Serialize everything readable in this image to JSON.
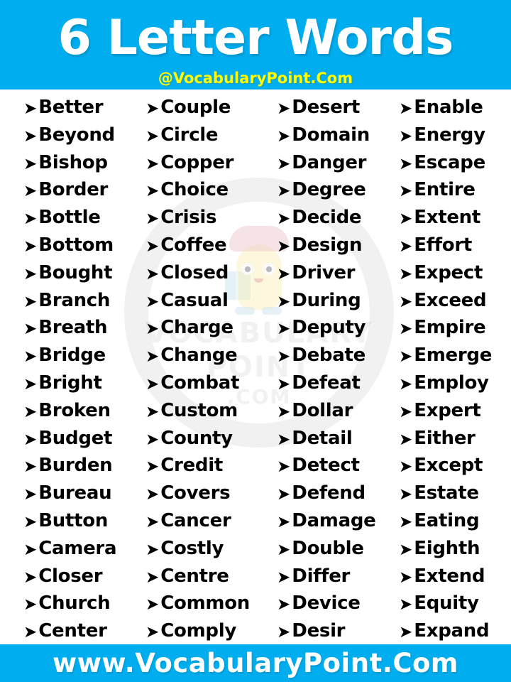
{
  "header": {
    "title": "6 Letter Words",
    "subtitle": "@VocabularyPoint.Com",
    "background_color": "#00ADEE",
    "title_color": "#FFFFFF",
    "subtitle_color": "#FFFF00"
  },
  "bullet_glyph": "➤",
  "bullet_icon_name": "arrow-bullet-icon",
  "watermark": {
    "line1": "VOCABULARY",
    "line2": "POINT",
    "line3": ".COM"
  },
  "columns": [
    {
      "index": 0,
      "words": [
        "Better",
        "Beyond",
        "Bishop",
        "Border",
        "Bottle",
        "Bottom",
        "Bought",
        "Branch",
        "Breath",
        "Bridge",
        "Bright",
        "Broken",
        "Budget",
        "Burden",
        "Bureau",
        "Button",
        "Camera",
        "Closer",
        "Church",
        "Center"
      ]
    },
    {
      "index": 1,
      "words": [
        "Couple",
        "Circle",
        "Copper",
        "Choice",
        "Crisis",
        "Coffee",
        "Closed",
        "Casual",
        "Charge",
        "Change",
        "Combat",
        "Custom",
        "County",
        "Credit",
        "Covers",
        "Cancer",
        "Costly",
        "Centre",
        "Common",
        "Comply"
      ]
    },
    {
      "index": 2,
      "words": [
        "Desert",
        "Domain",
        "Danger",
        "Degree",
        "Decide",
        "Design",
        "Driver",
        "During",
        "Deputy",
        "Debate",
        "Defeat",
        "Dollar",
        "Detail",
        "Detect",
        "Defend",
        "Damage",
        "Double",
        "Differ",
        "Device",
        "Desir"
      ]
    },
    {
      "index": 3,
      "words": [
        "Enable",
        "Energy",
        "Escape",
        "Entire",
        "Extent",
        "Effort",
        "Expect",
        "Exceed",
        "Empire",
        "Emerge",
        "Employ",
        "Expert",
        "Either",
        "Except",
        "Estate",
        "Eating",
        "Eighth",
        "Extend",
        "Equity",
        "Expand"
      ]
    }
  ],
  "footer": {
    "text": "www.VocabularyPoint.Com",
    "background_color": "#00ADEE",
    "text_color": "#FFFFFF"
  }
}
